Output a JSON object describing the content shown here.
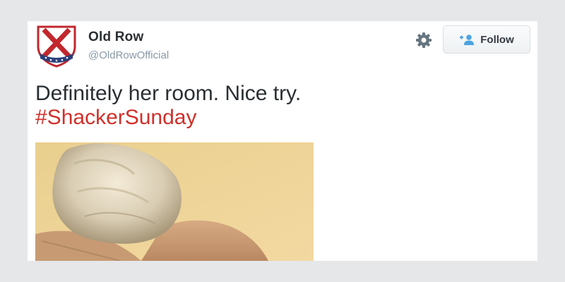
{
  "user": {
    "name": "Old Row",
    "handle": "@OldRowOfficial",
    "avatar_icon": "old-row-crest-logo"
  },
  "header": {
    "settings_icon": "gear-icon",
    "follow_label": "Follow",
    "follow_icon": "add-user-icon"
  },
  "tweet": {
    "text": "Definitely her room. Nice try.",
    "hashtag": "#ShackerSunday"
  },
  "media": {
    "type": "photo",
    "description_icon": "photo-thumbnail"
  },
  "colors": {
    "background": "#e6e7e9",
    "card": "#ffffff",
    "hashtag": "#d12f2a",
    "follow_icon": "#4ba3e1",
    "logo_red": "#c1272d",
    "logo_blue": "#2b3f7a"
  }
}
